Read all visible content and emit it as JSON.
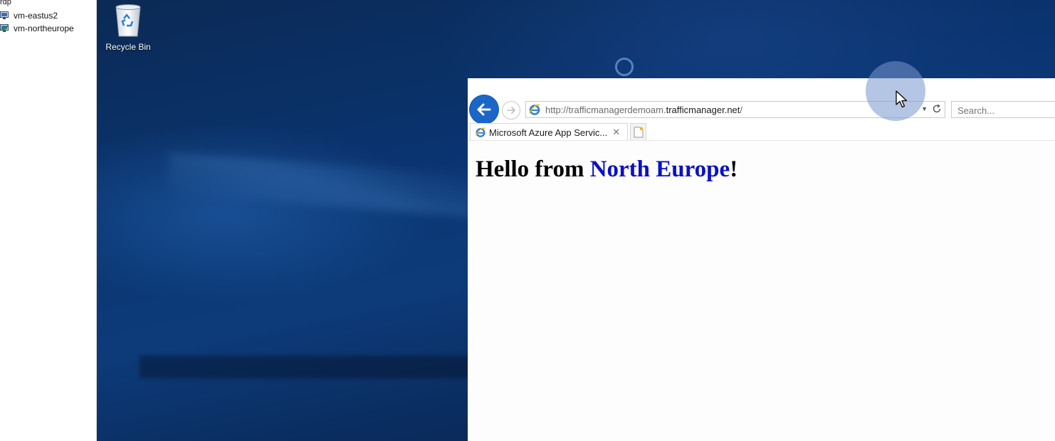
{
  "rdp_panel": {
    "root_label": "rdp",
    "connections": [
      {
        "name": "vm-eastus2",
        "status": "idle"
      },
      {
        "name": "vm-northeurope",
        "status": "connected"
      }
    ]
  },
  "desktop": {
    "icons": [
      {
        "label": "Recycle Bin",
        "icon": "recycle-bin-icon"
      }
    ]
  },
  "browser": {
    "address_bar": {
      "url_prefix": "http://trafficmanagerdemoam.",
      "url_host": "trafficmanager.net",
      "url_suffix": "/"
    },
    "search": {
      "placeholder": "Search..."
    },
    "tabs": [
      {
        "title": "Microsoft Azure App Servic..."
      }
    ],
    "page": {
      "heading_prefix": "Hello from ",
      "heading_region": "North Europe",
      "heading_suffix": "!"
    }
  },
  "colors": {
    "desktop_blue": "#0a3470",
    "back_button_blue": "#1a67c9",
    "heading_region_blue": "#0a10c8",
    "connected_check_green": "#2a8a2a"
  }
}
